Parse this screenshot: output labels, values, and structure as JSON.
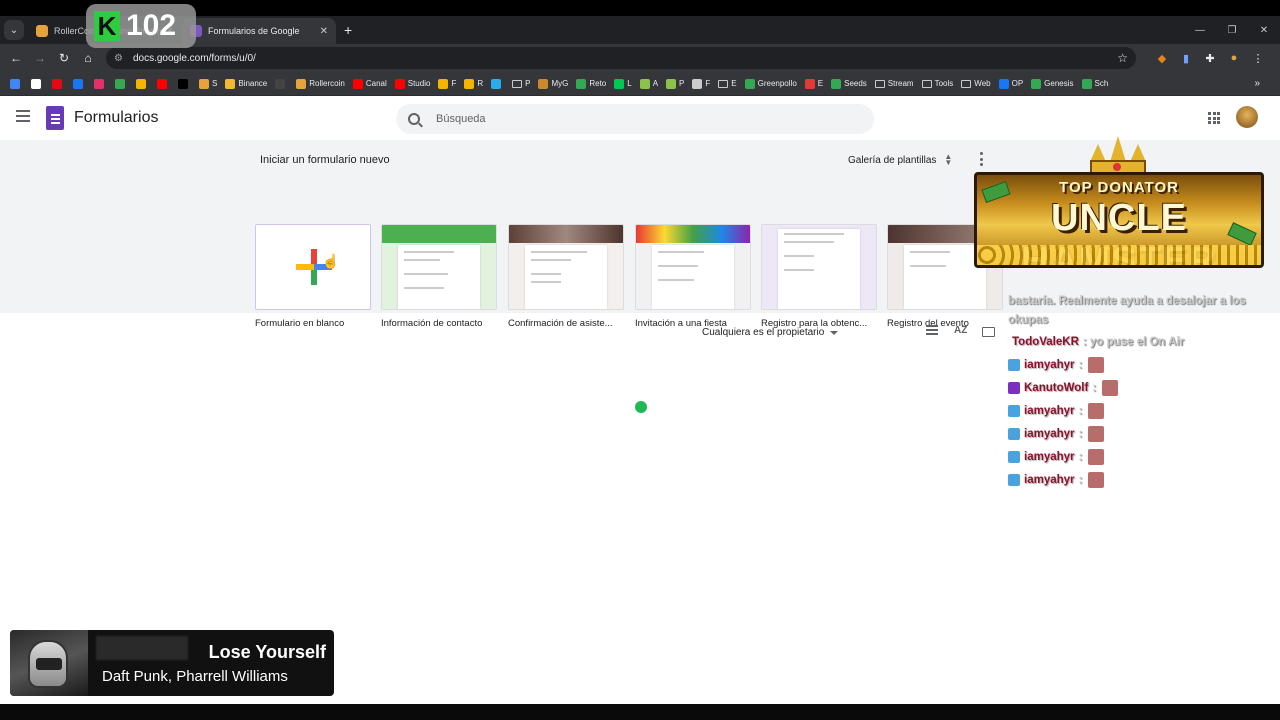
{
  "tabs": [
    {
      "title": "RollerCoin – Online Bitcoin Mining",
      "active": false,
      "color": "#e6a23c"
    },
    {
      "title": "Formularios de Google",
      "active": true,
      "color": "#7e57c2"
    }
  ],
  "tab_search_icon": "chevron-down-icon",
  "new_tab_icon": "+",
  "window_controls": [
    "—",
    "❐",
    "✕"
  ],
  "toolbar": {
    "url": "docs.google.com/forms/u/0/"
  },
  "bookmarks": [
    {
      "label": "",
      "color": "#4285f4"
    },
    {
      "label": "",
      "color": "#ffffff"
    },
    {
      "label": "",
      "color": "#e50914"
    },
    {
      "label": "",
      "color": "#1877f2"
    },
    {
      "label": "",
      "color": "#e1306c"
    },
    {
      "label": "",
      "color": "#34a853"
    },
    {
      "label": "",
      "color": "#f4b400"
    },
    {
      "label": "",
      "color": "#ff0000"
    },
    {
      "label": "",
      "color": "#000000"
    },
    {
      "label": "S",
      "color": "#e6a23c"
    },
    {
      "label": "Binance",
      "color": "#f3ba2f"
    },
    {
      "label": "",
      "color": "#444444"
    },
    {
      "label": "Rollercoin",
      "color": "#e6a23c"
    },
    {
      "label": "Canal",
      "color": "#ff0000"
    },
    {
      "label": "Studio",
      "color": "#ff0000"
    },
    {
      "label": "F",
      "color": "#f4b400"
    },
    {
      "label": "R",
      "color": "#f4b400"
    },
    {
      "label": "",
      "color": "#2aabee"
    },
    {
      "label": "P",
      "folder": true
    },
    {
      "label": "MyG",
      "color": "#c98a2c"
    },
    {
      "label": "Reto",
      "color": "#34a853"
    },
    {
      "label": "L",
      "color": "#00c853"
    },
    {
      "label": "A",
      "color": "#8bc34a"
    },
    {
      "label": "P",
      "color": "#8bc34a"
    },
    {
      "label": "F",
      "color": "#cccccc"
    },
    {
      "label": "E",
      "folder": true
    },
    {
      "label": "Greenpollo",
      "color": "#34a853"
    },
    {
      "label": "E",
      "color": "#e53935"
    },
    {
      "label": "Seeds",
      "color": "#34a853"
    },
    {
      "label": "Stream",
      "folder": true
    },
    {
      "label": "Tools",
      "folder": true
    },
    {
      "label": "Web",
      "folder": true
    },
    {
      "label": "OP",
      "color": "#1877f2"
    },
    {
      "label": "Genesis",
      "color": "#34a853"
    },
    {
      "label": "Sch",
      "color": "#34a853"
    }
  ],
  "bookmarks_more": "»",
  "app": {
    "title": "Formularios",
    "search_placeholder": "Búsqueda"
  },
  "overlay_counter": {
    "letter": "K",
    "number": "102"
  },
  "start": {
    "heading": "Iniciar un formulario nuevo",
    "gallery_label": "Galería de plantillas",
    "templates": [
      {
        "label": "Formulario en blanco",
        "accent": "#ffffff"
      },
      {
        "label": "Información de contacto",
        "accent": "#4caf50"
      },
      {
        "label": "Confirmación de asiste...",
        "accent": "#795548"
      },
      {
        "label": "Invitación a una fiesta",
        "accent": "#9e9e9e"
      },
      {
        "label": "Registro para la obtenc...",
        "accent": "#7e57c2"
      },
      {
        "label": "Registro del evento",
        "accent": "#8d6e63"
      }
    ]
  },
  "filter": {
    "owner_label": "Cualquiera es el propietario",
    "sort_icon_text": "AZ"
  },
  "donator": {
    "top_line": "TOP DONATOR",
    "name": "UNCLE HAMSTER"
  },
  "chat": {
    "continuation": "bastaría. Realmente ayuda a desalojar a los okupas",
    "messages": [
      {
        "user": "TodoValeKR",
        "text": ": yo puse el On Air",
        "badge": "",
        "emote": false
      },
      {
        "user": "iamyahyr",
        "text": ":",
        "badge": "#4aa3df",
        "emote": true
      },
      {
        "user": "KanutoWolf",
        "text": ":",
        "badge": "#7b2fbe",
        "emote": true
      },
      {
        "user": "iamyahyr",
        "text": ":",
        "badge": "#4aa3df",
        "emote": true
      },
      {
        "user": "iamyahyr",
        "text": ":",
        "badge": "#4aa3df",
        "emote": true
      },
      {
        "user": "iamyahyr",
        "text": ":",
        "badge": "#4aa3df",
        "emote": true
      },
      {
        "user": "iamyahyr",
        "text": ":",
        "badge": "#4aa3df",
        "emote": true
      }
    ]
  },
  "now_playing": {
    "song": "Lose Yourself",
    "artist": "Daft Punk, Pharrell Williams"
  }
}
